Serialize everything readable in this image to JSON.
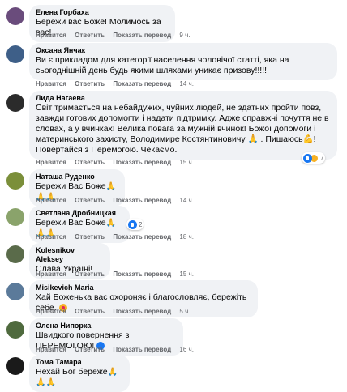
{
  "labels": {
    "like": "Нравится",
    "reply": "Ответить",
    "translate": "Показать перевод"
  },
  "comments": [
    {
      "author": "Елена Горбаха",
      "text": "Бережи вас Боже! Молимось за вас!",
      "time": "9 ч.",
      "avatar_color": "#6a4c7c"
    },
    {
      "author": "Оксана Янчак",
      "text": "Ви є прикладом для категорії населення чоловічої статті, яка на сьогоднішній день будь якими шляхами уникає призову!!!!!",
      "time": "14 ч.",
      "avatar_color": "#3e5f88"
    },
    {
      "author": "Лида Нагаева",
      "text": "Світ тримається на небайдужих, чуйних людей, не здатних пройти повз, завжди готових допомогти і надати підтримку. Адже справжні почуття не в словах, а у вчинках! Велика повага за мужній вчинок! Божої допомоги і материнського захисту, Володимире Костянтиновичу 🙏 . Пишаюсь💪! Повертайся з Перемогою. Чекаємо.",
      "time": "15 ч.",
      "reaction_count": "7",
      "avatar_color": "#2b2b2b"
    },
    {
      "author": "Наташа Руденко",
      "text": "Бережи Вас Боже",
      "time": "14 ч.",
      "emoji": "🙏🙏🙏",
      "avatar_color": "#7b8f3a"
    },
    {
      "author": "Светлана Дробницкая",
      "text": "Бережи Вас Боже",
      "time": "18 ч.",
      "emoji": "🙏🙏🙏",
      "reaction_count": "2",
      "avatar_color": "#8aa36b"
    },
    {
      "author": "Kolesnikov Aleksey",
      "text": "Слава Україні!",
      "time": "15 ч.",
      "avatar_color": "#5a6b4a"
    },
    {
      "author": "Misikevich Maria",
      "text": "Хай Боженька вас охороняє і благословляє, бережіть себе.",
      "time": "5 ч.",
      "avatar_color": "#5b7a9a"
    },
    {
      "author": "Олена Нипорка",
      "text": "Швидкого повернення з ПЕРЕМОГОЮ!",
      "time": "16 ч.",
      "avatar_color": "#4f6a3e"
    },
    {
      "author": "Тома Тамара",
      "text": "Нехай Бог береже",
      "emoji": "🙏🙏🙏",
      "avatar_color": "#1a1a1a"
    }
  ],
  "colors": {
    "bubble_bg": "#f0f2f5",
    "meta_text": "#65676b",
    "like_blue": "#1877f2"
  }
}
